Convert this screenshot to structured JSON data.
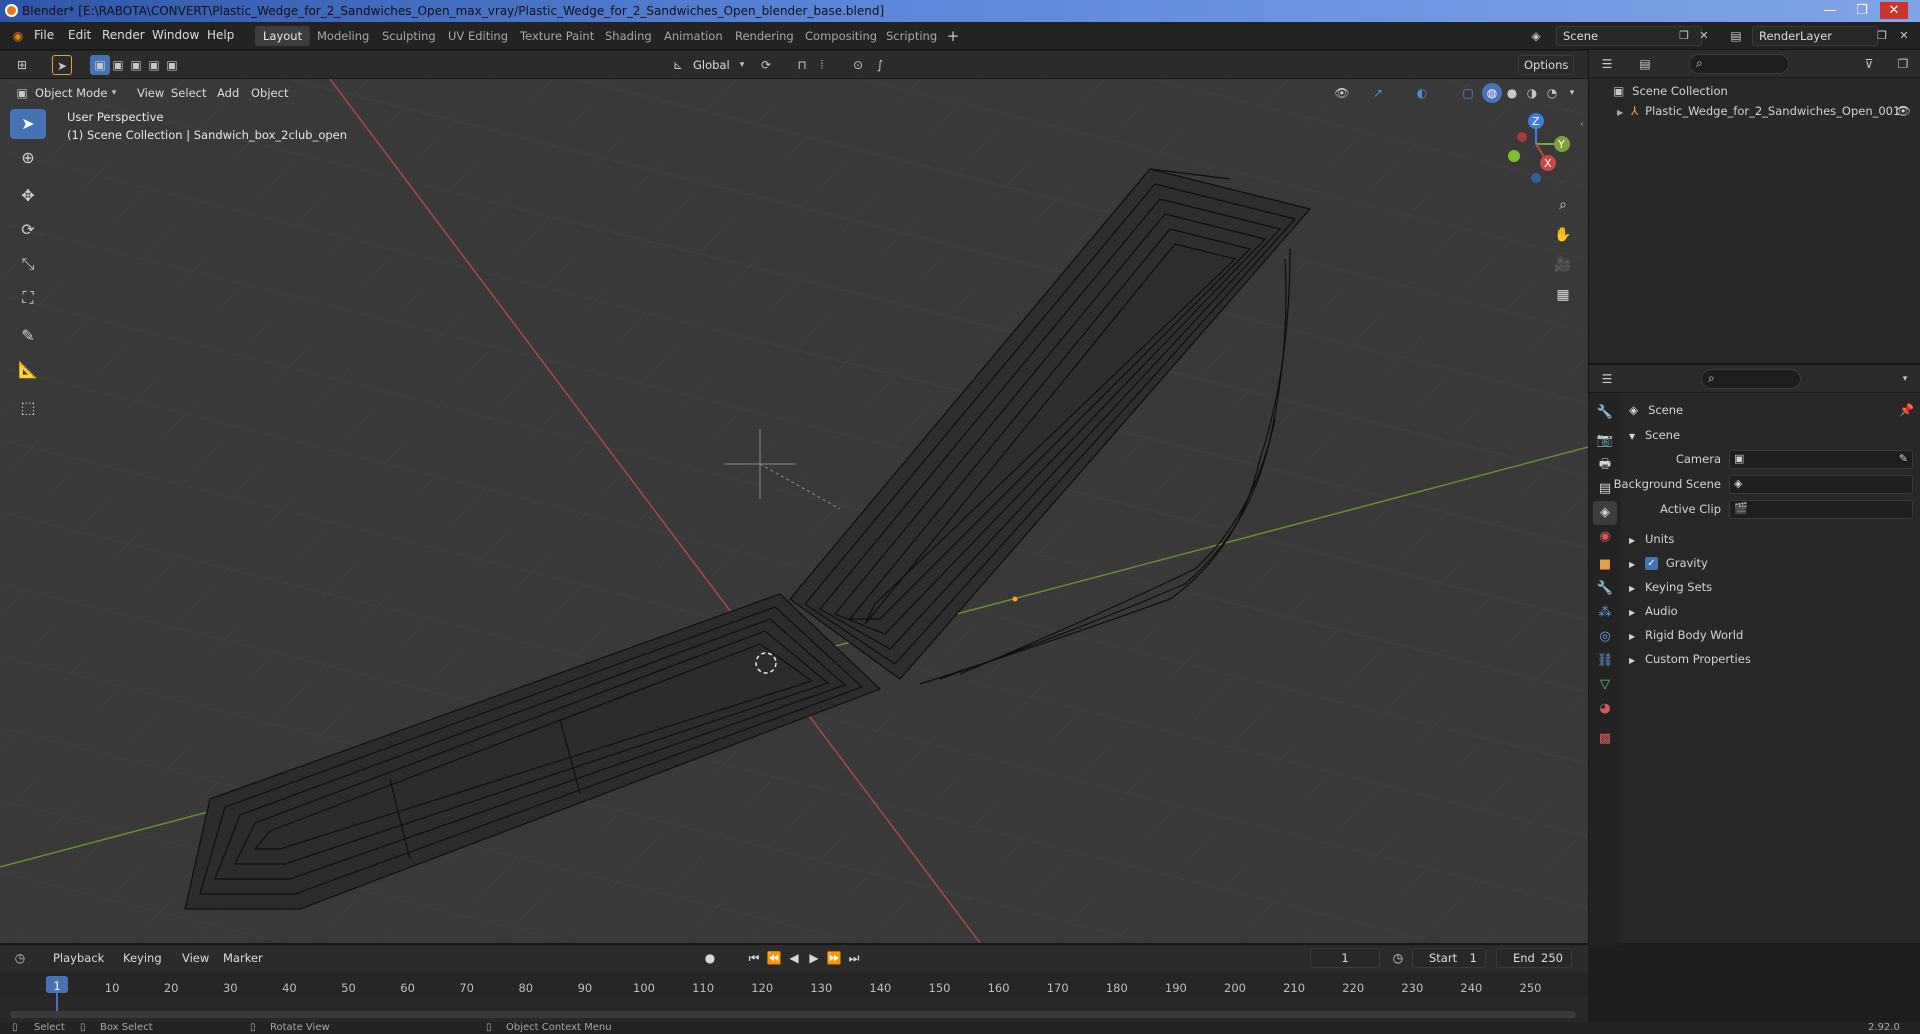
{
  "window": {
    "title": "Blender* [E:\\RABOTA\\CONVERT\\Plastic_Wedge_for_2_Sandwiches_Open_max_vray/Plastic_Wedge_for_2_Sandwiches_Open_blender_base.blend]"
  },
  "menu": [
    "File",
    "Edit",
    "Render",
    "Window",
    "Help"
  ],
  "workspaces": [
    "Layout",
    "Modeling",
    "Sculpting",
    "UV Editing",
    "Texture Paint",
    "Shading",
    "Animation",
    "Rendering",
    "Compositing",
    "Scripting"
  ],
  "scene": {
    "name": "Scene",
    "render_layer": "RenderLayer"
  },
  "header": {
    "transform_orientation": "Global",
    "options": "Options"
  },
  "viewport_header": {
    "mode": "Object Mode",
    "view": "View",
    "select": "Select",
    "add": "Add",
    "object": "Object"
  },
  "viewport": {
    "perspective": "User Perspective",
    "collection": "(1) Scene Collection | Sandwich_box_2club_open",
    "axis_x": "X",
    "axis_y": "Y",
    "axis_z": "Z"
  },
  "outliner": {
    "root": "Scene Collection",
    "item": "Plastic_Wedge_for_2_Sandwiches_Open_001"
  },
  "properties": {
    "context": "Scene",
    "panel": "Scene",
    "camera_label": "Camera",
    "background_label": "Background Scene",
    "clip_label": "Active Clip",
    "sections": [
      "Units",
      "Gravity",
      "Keying Sets",
      "Audio",
      "Rigid Body World",
      "Custom Properties"
    ],
    "gravity_checked": true
  },
  "timeline": {
    "playback": "Playback",
    "keying": "Keying",
    "view": "View",
    "marker": "Marker",
    "current_frame": "1",
    "start_label": "Start",
    "start": "1",
    "end_label": "End",
    "end": "250",
    "ticks": [
      "1",
      "10",
      "20",
      "30",
      "40",
      "50",
      "60",
      "70",
      "80",
      "90",
      "100",
      "110",
      "120",
      "130",
      "140",
      "150",
      "160",
      "170",
      "180",
      "190",
      "200",
      "210",
      "220",
      "230",
      "240",
      "250"
    ]
  },
  "status": {
    "select": "Select",
    "box_select": "Box Select",
    "rotate": "Rotate View",
    "context_menu": "Object Context Menu",
    "version": "2.92.0"
  },
  "colors": {
    "accent": "#4772b3",
    "x_axis": "#c64848",
    "y_axis": "#7ea23d",
    "z_axis": "#3f7fd6",
    "viewport_bg": "#393939"
  }
}
